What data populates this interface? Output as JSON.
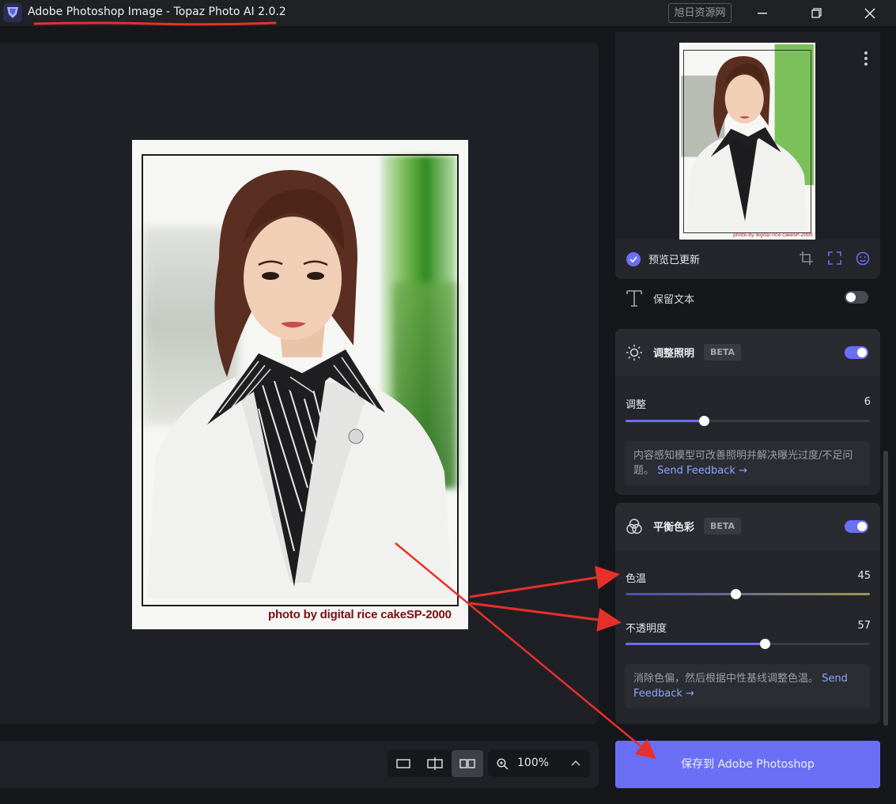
{
  "window": {
    "title": "Adobe Photoshop Image - Topaz Photo AI 2.0.2",
    "watermark": "旭日资源网"
  },
  "canvas": {
    "photo_credit": "photo by digital rice cakeSP-2000"
  },
  "bottom_bar": {
    "zoom_level": "100%"
  },
  "preview": {
    "status_label": "预览已更新",
    "thumbnail_credit": "photo by digital rice cakeSP-2000"
  },
  "keep_text": {
    "label": "保留文本",
    "enabled": false
  },
  "adjust_lighting": {
    "title": "调整照明",
    "badge": "BETA",
    "enabled": true,
    "slider_label": "调整",
    "slider_value": "6",
    "slider_fraction": 0.32,
    "description": "内容感知模型可改善照明并解决曝光过度/不足问题。",
    "feedback_link": "Send Feedback →"
  },
  "balance_color": {
    "title": "平衡色彩",
    "badge": "BETA",
    "enabled": true,
    "temperature_label": "色温",
    "temperature_value": "45",
    "temperature_fraction": 0.45,
    "opacity_label": "不透明度",
    "opacity_value": "57",
    "opacity_fraction": 0.57,
    "description": "消除色偏，然后根据中性基线调整色温。",
    "feedback_link": "Send Feedback →"
  },
  "save_button": {
    "label": "保存到 Adobe Photoshop"
  },
  "colors": {
    "accent": "#6a6ff6",
    "background": "#16171b",
    "panel": "#25262c",
    "annotation_red": "#e8302b"
  }
}
